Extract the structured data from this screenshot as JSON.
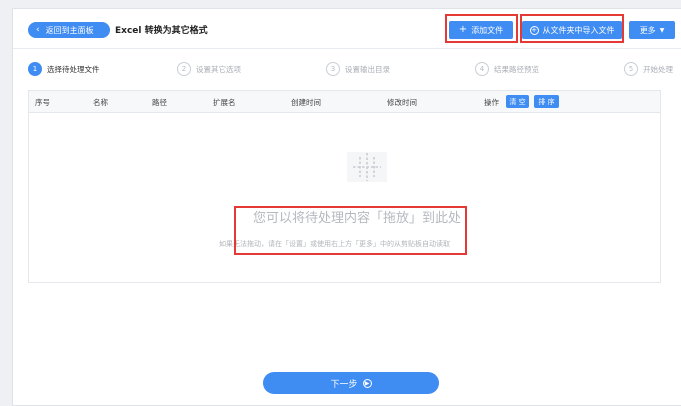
{
  "header": {
    "back_label": "返回到主面板",
    "title": "Excel 转换为其它格式",
    "add_file_label": "添加文件",
    "import_folder_label": "从文件夹中导入文件",
    "more_label": "更多"
  },
  "steps": [
    {
      "num": "1",
      "label": "选择待处理文件"
    },
    {
      "num": "2",
      "label": "设置其它选项"
    },
    {
      "num": "3",
      "label": "设置输出目录"
    },
    {
      "num": "4",
      "label": "结果路径预览"
    },
    {
      "num": "5",
      "label": "开始处理"
    }
  ],
  "table": {
    "columns": [
      "序号",
      "名称",
      "路径",
      "扩展名",
      "创建时间",
      "修改时间",
      "操作"
    ],
    "clear_label": "清 空",
    "sort_label": "排 序"
  },
  "empty": {
    "main_text": "您可以将待处理内容「拖放」到此处",
    "hint_text": "如果无法拖动，请在「设置」或使用右上方「更多」中的从剪贴板自动读取"
  },
  "footer": {
    "next_label": "下一步"
  },
  "colors": {
    "accent": "#3f8cf3",
    "highlight": "#e53935"
  }
}
